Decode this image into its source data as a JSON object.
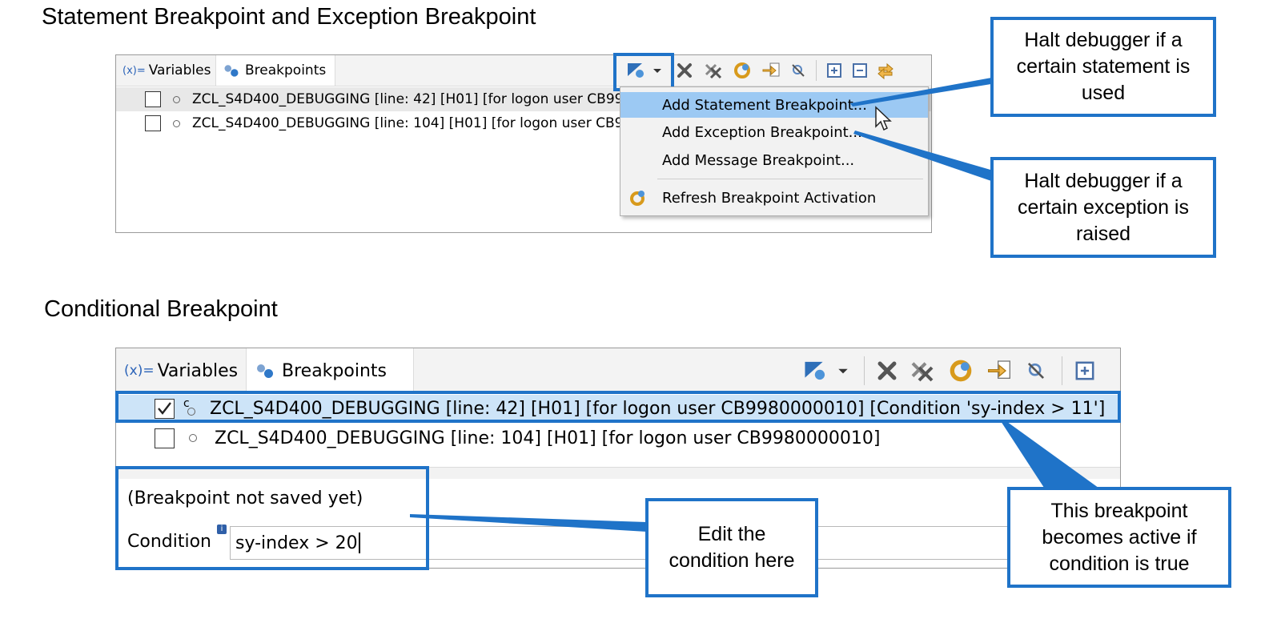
{
  "section1": {
    "title": "Statement Breakpoint and Exception Breakpoint"
  },
  "section2": {
    "title": "Conditional Breakpoint"
  },
  "tabs": {
    "variables_prefix": "(x)=",
    "variables": "Variables",
    "breakpoints": "Breakpoints"
  },
  "top_panel": {
    "rows": [
      {
        "checked": false,
        "text": "ZCL_S4D400_DEBUGGING [line: 42] [H01] [for logon user CB998"
      },
      {
        "checked": false,
        "text": "ZCL_S4D400_DEBUGGING [line: 104] [H01] [for logon user CB99"
      }
    ],
    "menu": {
      "items": [
        "Add Statement Breakpoint...",
        "Add Exception Breakpoint...",
        "Add Message Breakpoint...",
        "Refresh Breakpoint Activation"
      ]
    }
  },
  "bottom_panel": {
    "rows": [
      {
        "checked": true,
        "text": "ZCL_S4D400_DEBUGGING [line: 42] [H01] [for logon user CB9980000010] [Condition 'sy-index > 11']"
      },
      {
        "checked": false,
        "text": "ZCL_S4D400_DEBUGGING [line: 104] [H01] [for logon user CB9980000010]"
      }
    ],
    "status": "(Breakpoint not saved yet)",
    "condition_label": "Condition",
    "condition_value": "sy-index > 20"
  },
  "callouts": {
    "statement": "Halt debugger if a certain statement is used",
    "exception": "Halt debugger if a certain exception is raised",
    "edit": "Edit the condition here",
    "active": "This breakpoint becomes active if condition is true"
  },
  "icons": [
    "add-breakpoint-icon",
    "dropdown-arrow-icon",
    "remove-icon",
    "remove-all-icon",
    "refresh-activation-icon",
    "import-icon",
    "skip-all-icon",
    "expand-all-icon",
    "collapse-all-icon",
    "link-editor-icon",
    "cursor-icon"
  ],
  "colors": {
    "accent": "#1f73c8",
    "menu_highlight": "#9cc9f3",
    "row_highlight": "#cde4f8"
  }
}
